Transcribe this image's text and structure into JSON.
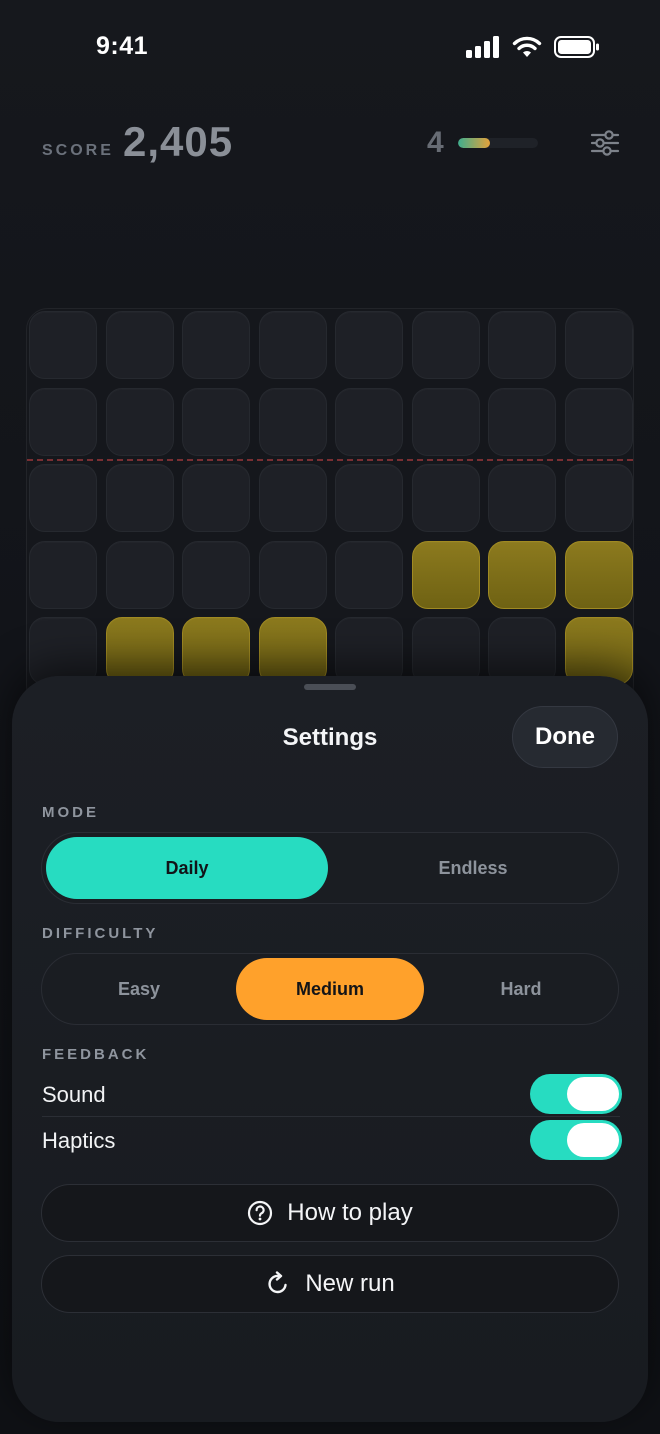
{
  "status_bar": {
    "time": "9:41"
  },
  "header": {
    "score_label": "SCORE",
    "score_value": "2,405",
    "level": "4",
    "level_progress_fraction": 0.4
  },
  "board": {
    "rows": [
      [
        0,
        0,
        0,
        0,
        0,
        0,
        0,
        0
      ],
      [
        0,
        0,
        0,
        0,
        0,
        0,
        0,
        0
      ],
      [
        0,
        0,
        0,
        0,
        0,
        0,
        0,
        0
      ],
      [
        0,
        0,
        0,
        0,
        0,
        1,
        1,
        1
      ],
      [
        0,
        1,
        1,
        1,
        0,
        0,
        0,
        1
      ]
    ],
    "filled_color": "#8c7a1e"
  },
  "settings": {
    "title": "Settings",
    "done_label": "Done",
    "mode": {
      "label": "MODE",
      "options": [
        "Daily",
        "Endless"
      ],
      "selected": "Daily"
    },
    "difficulty": {
      "label": "DIFFICULTY",
      "options": [
        "Easy",
        "Medium",
        "Hard"
      ],
      "selected": "Medium"
    },
    "feedback": {
      "label": "FEEDBACK",
      "sound_label": "Sound",
      "sound_on": true,
      "haptics_label": "Haptics",
      "haptics_on": true
    },
    "how_to_play_label": "How to play",
    "new_run_label": "New run"
  },
  "colors": {
    "accent_teal": "#27dcc1",
    "accent_orange": "#ffa12b"
  }
}
